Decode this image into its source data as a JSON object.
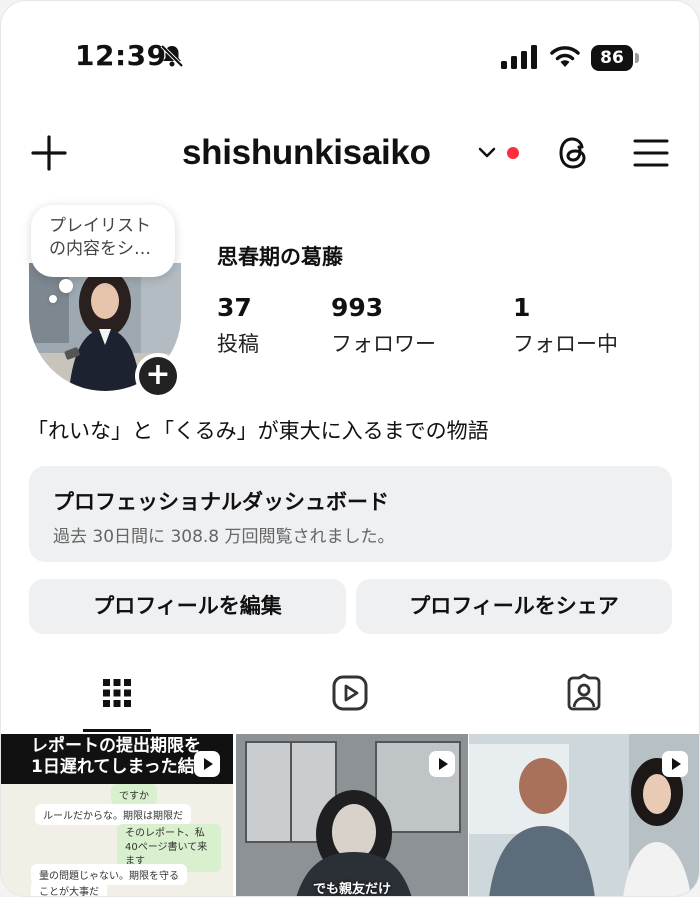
{
  "status_bar": {
    "time": "12:39",
    "battery": "86"
  },
  "header": {
    "username": "shishunkisaiko"
  },
  "profile": {
    "tooltip_line1": "プレイリスト",
    "tooltip_line2": "の内容をシ…",
    "display_name": "思春期の葛藤",
    "stats": [
      {
        "value": "37",
        "label": "投稿"
      },
      {
        "value": "993",
        "label": "フォロワー"
      },
      {
        "value": "1",
        "label": "フォロー中"
      }
    ],
    "bio": "「れいな」と「くるみ」が東大に入るまでの物語"
  },
  "dashboard": {
    "title": "プロフェッショナルダッシュボード",
    "subtitle": "過去 30日間に 308.8 万回閲覧されました。"
  },
  "actions": {
    "edit": "プロフィールを編集",
    "share": "プロフィールをシェア"
  },
  "posts": [
    {
      "headline_1": "レポートの提出期限を",
      "headline_2": "1日遅れてしまった結果",
      "chat": [
        "ですか",
        "ルールだからな。期限は期限だ",
        "そのレポート、私40ページ書いて来ます",
        "量の問題じゃない。期限を守る",
        "ことが大事だ"
      ]
    },
    {
      "caption": "でも親友だけ"
    },
    {}
  ],
  "colors": {
    "notification_dot": "#ff2d3d",
    "button_bg": "#eff0f2"
  }
}
